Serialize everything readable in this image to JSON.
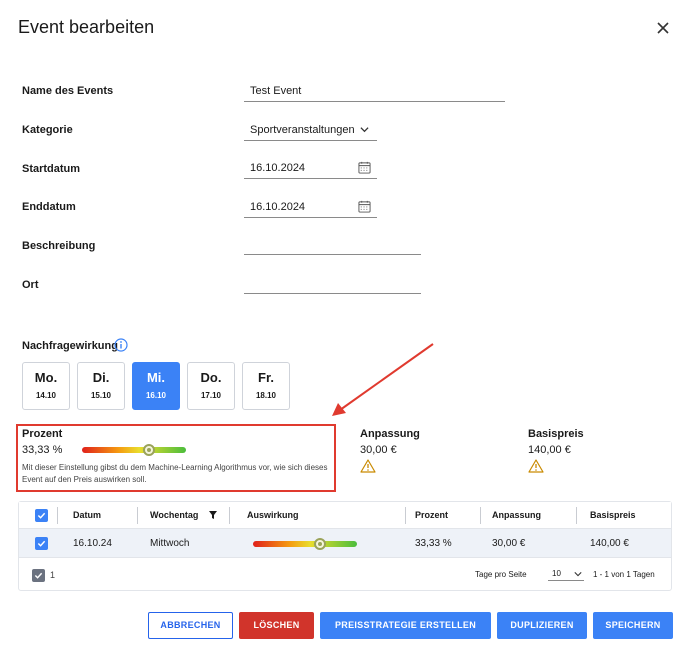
{
  "dialog": {
    "title": "Event bearbeiten"
  },
  "form": {
    "name": {
      "label": "Name des Events",
      "value": "Test Event"
    },
    "category": {
      "label": "Kategorie",
      "value": "Sportveranstaltungen"
    },
    "start": {
      "label": "Startdatum",
      "value": "16.10.2024"
    },
    "end": {
      "label": "Enddatum",
      "value": "16.10.2024"
    },
    "description": {
      "label": "Beschreibung",
      "value": ""
    },
    "location": {
      "label": "Ort",
      "value": ""
    }
  },
  "demand": {
    "label": "Nachfragewirkung",
    "days": [
      {
        "day": "Mo.",
        "date": "14.10",
        "active": false
      },
      {
        "day": "Di.",
        "date": "15.10",
        "active": false
      },
      {
        "day": "Mi.",
        "date": "16.10",
        "active": true
      },
      {
        "day": "Do.",
        "date": "17.10",
        "active": false
      },
      {
        "day": "Fr.",
        "date": "18.10",
        "active": false
      }
    ],
    "percent_label": "Prozent",
    "percent_value": "33,33 %",
    "slider_level": 0.64,
    "help_text": "Mit dieser Einstellung gibst du dem Machine-Learning Algorithmus vor, wie sich dieses Event auf den Preis auswirken soll.",
    "adjustment_label": "Anpassung",
    "adjustment_value": "30,00 €",
    "base_label": "Basispreis",
    "base_value": "140,00 €"
  },
  "table": {
    "headers": [
      "Datum",
      "Wochentag",
      "Auswirkung",
      "Prozent",
      "Anpassung",
      "Basispreis"
    ],
    "rows": [
      {
        "date": "16.10.24",
        "weekday": "Mittwoch",
        "impact_level": 0.64,
        "percent": "33,33 %",
        "adjustment": "30,00 €",
        "base": "140,00 €"
      }
    ],
    "selected_count": "1",
    "per_page_label": "Tage pro Seite",
    "per_page_value": "10",
    "range_text": "1 - 1 von 1 Tagen"
  },
  "buttons": {
    "cancel": "ABBRECHEN",
    "delete": "LÖSCHEN",
    "strategy": "PREISSTRATEGIE ERSTELLEN",
    "duplicate": "DUPLIZIEREN",
    "save": "SPEICHERN"
  },
  "colors": {
    "accent": "#3b82f6",
    "danger": "#d1342b",
    "highlight": "#e03a2f",
    "warning": "#c98a00"
  }
}
